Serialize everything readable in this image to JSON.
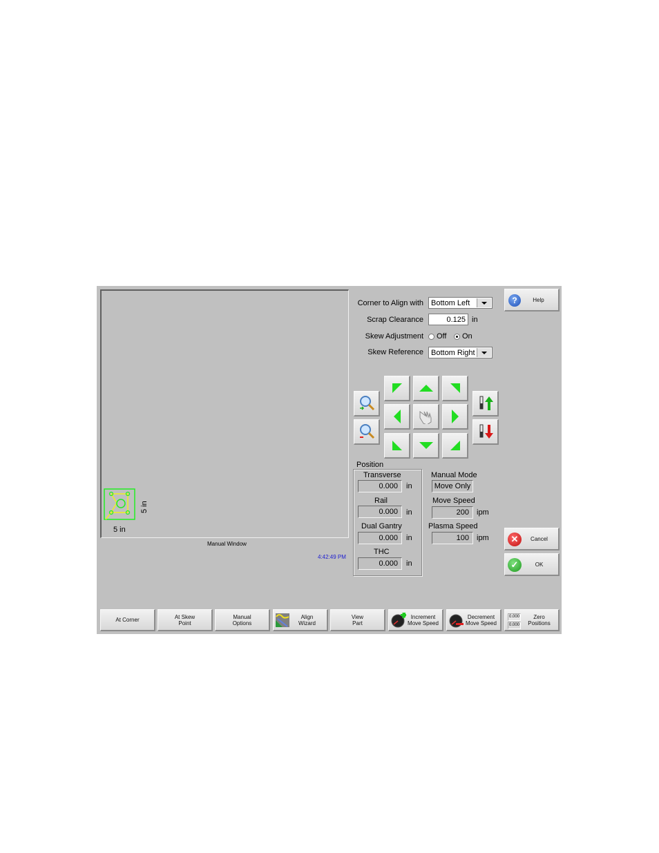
{
  "view": {
    "window_label": "Manual Window",
    "clock": "4:42:49 PM",
    "part_width_label": "5 in",
    "part_height_label": "5 in"
  },
  "align": {
    "corner_label": "Corner to Align with",
    "corner_value": "Bottom Left",
    "scrap_label": "Scrap Clearance",
    "scrap_value": "0.125",
    "scrap_unit": "in",
    "skew_adj_label": "Skew Adjustment",
    "skew_off": "Off",
    "skew_on": "On",
    "skew_selected": "On",
    "skew_ref_label": "Skew Reference",
    "skew_ref_value": "Bottom Right"
  },
  "buttons": {
    "help": "Help",
    "cancel": "Cancel",
    "ok": "OK"
  },
  "position": {
    "group_label": "Position",
    "transverse_label": "Transverse",
    "transverse_value": "0.000",
    "rail_label": "Rail",
    "rail_value": "0.000",
    "dual_label": "Dual Gantry",
    "dual_value": "0.000",
    "thc_label": "THC",
    "thc_value": "0.000",
    "unit": "in"
  },
  "mode": {
    "manual_mode_label": "Manual Mode",
    "manual_mode_value": "Move Only",
    "move_speed_label": "Move Speed",
    "move_speed_value": "200",
    "plasma_speed_label": "Plasma Speed",
    "plasma_speed_value": "100",
    "speed_unit": "ipm"
  },
  "softkeys": [
    {
      "line1": "At Corner",
      "line2": ""
    },
    {
      "line1": "At Skew",
      "line2": "Point"
    },
    {
      "line1": "Manual",
      "line2": "Options"
    },
    {
      "line1": "Align",
      "line2": "Wizard"
    },
    {
      "line1": "View",
      "line2": "Part"
    },
    {
      "line1": "Increment",
      "line2": "Move Speed"
    },
    {
      "line1": "Decrement",
      "line2": "Move Speed"
    },
    {
      "line1": "Zero",
      "line2": "Positions"
    }
  ],
  "zero_icon_values": [
    "0.000",
    "0.000"
  ],
  "colors": {
    "panel": "#c0c0c0",
    "arrow_green": "#22dd22",
    "clock_blue": "#2020d0",
    "part_green": "#22ee22",
    "part_yellow": "#f0f020"
  }
}
